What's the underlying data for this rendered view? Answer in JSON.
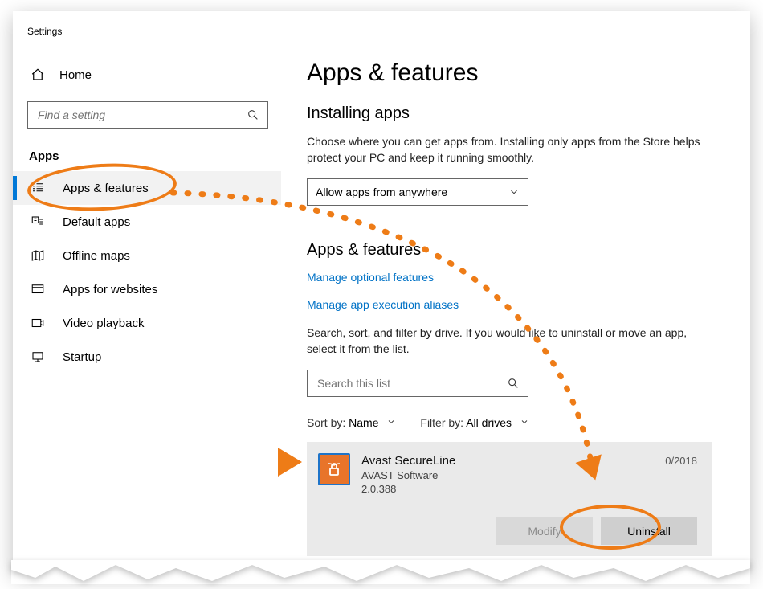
{
  "window_title": "Settings",
  "home_label": "Home",
  "search_placeholder": "Find a setting",
  "sidebar_section": "Apps",
  "sidebar": {
    "items": [
      {
        "label": "Apps & features"
      },
      {
        "label": "Default apps"
      },
      {
        "label": "Offline maps"
      },
      {
        "label": "Apps for websites"
      },
      {
        "label": "Video playback"
      },
      {
        "label": "Startup"
      }
    ]
  },
  "main": {
    "title": "Apps & features",
    "install_heading": "Installing apps",
    "install_body": "Choose where you can get apps from. Installing only apps from the Store helps protect your PC and keep it running smoothly.",
    "install_dropdown": "Allow apps from anywhere",
    "list_heading": "Apps & features",
    "link_optional": "Manage optional features",
    "link_aliases": "Manage app execution aliases",
    "list_body": "Search, sort, and filter by drive. If you would like to uninstall or move an app, select it from the list.",
    "list_search_placeholder": "Search this list",
    "sort_label": "Sort by:",
    "sort_value": "Name",
    "filter_label": "Filter by:",
    "filter_value": "All drives",
    "app": {
      "name": "Avast SecureLine",
      "publisher": "AVAST Software",
      "version": "2.0.388",
      "date": "0/2018",
      "modify_label": "Modify",
      "uninstall_label": "Uninstall"
    }
  },
  "colors": {
    "accent": "#0078d7",
    "link": "#0072c6",
    "annotation": "#ee7c17"
  }
}
